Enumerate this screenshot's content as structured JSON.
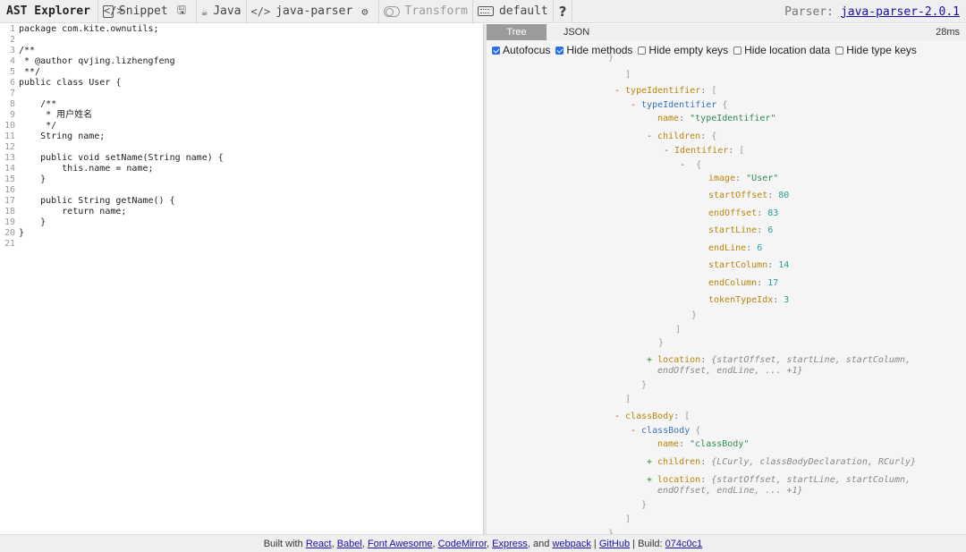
{
  "toolbar": {
    "title": "AST Explorer",
    "snippet_label": "Snippet",
    "language_label": "Java",
    "parser_label": "java-parser",
    "transform_label": "Transform",
    "keymap_label": "default",
    "help_label": "?",
    "parser_info_label": "Parser:",
    "parser_version": "java-parser-2.0.1",
    "icons": {
      "snippet": "file-code-icon",
      "save": "save-icon",
      "language": "java-icon",
      "parser": "code-icon",
      "settings": "gear-icon",
      "transform": "toggle-icon",
      "keymap": "keyboard-icon",
      "help": "question-icon"
    }
  },
  "editor": {
    "lines": [
      {
        "num": "1",
        "text": "package com.kite.ownutils;"
      },
      {
        "num": "2",
        "text": ""
      },
      {
        "num": "3",
        "text": "/**"
      },
      {
        "num": "4",
        "text": " * @author qvjing.lizhengfeng"
      },
      {
        "num": "5",
        "text": " **/"
      },
      {
        "num": "6",
        "text": "public class User {"
      },
      {
        "num": "7",
        "text": ""
      },
      {
        "num": "8",
        "text": "    /**"
      },
      {
        "num": "9",
        "text": "     * 用户姓名"
      },
      {
        "num": "10",
        "text": "     */"
      },
      {
        "num": "11",
        "text": "    String name;"
      },
      {
        "num": "12",
        "text": ""
      },
      {
        "num": "13",
        "text": "    public void setName(String name) {"
      },
      {
        "num": "14",
        "text": "        this.name = name;"
      },
      {
        "num": "15",
        "text": "    }"
      },
      {
        "num": "16",
        "text": ""
      },
      {
        "num": "17",
        "text": "    public String getName() {"
      },
      {
        "num": "18",
        "text": "        return name;"
      },
      {
        "num": "19",
        "text": "    }"
      },
      {
        "num": "20",
        "text": "}"
      },
      {
        "num": "21",
        "text": ""
      }
    ]
  },
  "pane": {
    "tabs": [
      {
        "label": "Tree"
      },
      {
        "label": "JSON"
      }
    ],
    "time": "28ms",
    "options": [
      {
        "label": "Autofocus",
        "checked": true
      },
      {
        "label": "Hide methods",
        "checked": true
      },
      {
        "label": "Hide empty keys",
        "checked": false
      },
      {
        "label": "Hide location data",
        "checked": false
      },
      {
        "label": "Hide type keys",
        "checked": false
      }
    ]
  },
  "tree": {
    "typeIdentifier_key": "typeIdentifier",
    "typeIdentifier_node": "typeIdentifier",
    "name_key": "name",
    "typeIdentifier_name": "\"typeIdentifier\"",
    "children_key": "children",
    "identifier_key": "Identifier",
    "image_key": "image",
    "image_val": "\"User\"",
    "startOffset_key": "startOffset",
    "startOffset_val": "80",
    "endOffset_key": "endOffset",
    "endOffset_val": "83",
    "startLine_key": "startLine",
    "startLine_val": "6",
    "endLine_key": "endLine",
    "endLine_val": "6",
    "startColumn_key": "startColumn",
    "startColumn_val": "14",
    "endColumn_key": "endColumn",
    "endColumn_val": "17",
    "tokenTypeIdx_key": "tokenTypeIdx",
    "tokenTypeIdx_val": "3",
    "location_key": "location",
    "location_summary_1": "{startOffset, startLine, startColumn,",
    "location_summary_2": "endOffset, endLine, ... +1}",
    "classBody_key": "classBody",
    "classBody_node": "classBody",
    "classBody_name": "\"classBody\"",
    "classBody_children_summary": "{LCurly, classBodyDeclaration, RCurly}"
  },
  "footer": {
    "prefix": "Built with",
    "react": "React",
    "babel": "Babel",
    "fontawesome": "Font Awesome",
    "codemirror": "CodeMirror",
    "express": "Express",
    "and": ", and",
    "webpack": "webpack",
    "github": "GitHub",
    "build_label": "| Build:",
    "build_hash": "074c0c1"
  }
}
